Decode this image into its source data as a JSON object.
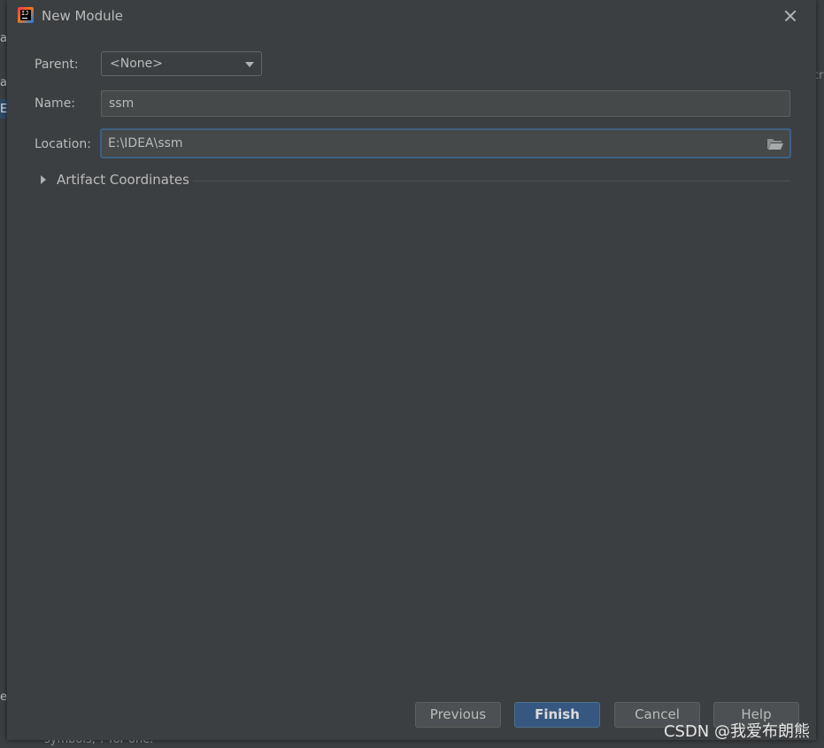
{
  "dialog": {
    "title": "New Module",
    "parent_label": "Parent:",
    "parent_value": "<None>",
    "name_label": "Name:",
    "name_value": "ssm",
    "location_label": "Location:",
    "location_value": "E:\\IDEA\\ssm",
    "artifact_label": "Artifact Coordinates",
    "buttons": {
      "previous": "Previous",
      "finish": "Finish",
      "cancel": "Cancel",
      "help": "Help"
    }
  },
  "background": {
    "fragments": [
      "ag",
      "as",
      "E:",
      "e"
    ],
    "right_fragment": "cr",
    "hint_text": "symbols, ? for one."
  },
  "watermark": "CSDN @我爱布朗熊",
  "colors": {
    "dialog_bg": "#3c3f41",
    "primary_button": "#365880",
    "focus_border": "#3d6185"
  }
}
